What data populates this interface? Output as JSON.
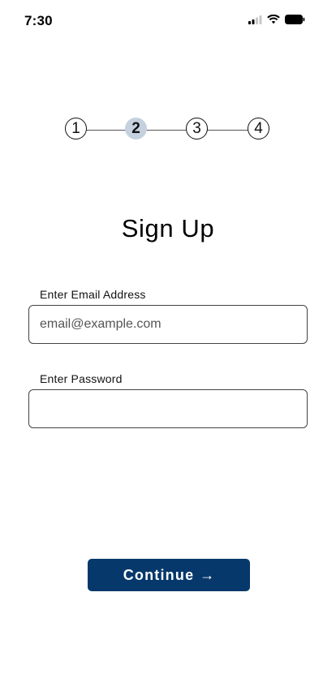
{
  "status_bar": {
    "time": "7:30",
    "icons": [
      "cellular-signal-icon",
      "wifi-icon",
      "battery-icon"
    ]
  },
  "stepper": {
    "steps": [
      "1",
      "2",
      "3",
      "4"
    ],
    "current_step": 2,
    "active_color": "#c5d1de"
  },
  "page": {
    "title": "Sign Up"
  },
  "form": {
    "email": {
      "label": "Enter Email Address",
      "placeholder": "email@example.com",
      "value": ""
    },
    "password": {
      "label": "Enter Password",
      "placeholder": "",
      "value": ""
    }
  },
  "continue_button": {
    "label": "Continue",
    "icon": "arrow-right-icon",
    "icon_glyph": "→",
    "color": "#06386b"
  }
}
